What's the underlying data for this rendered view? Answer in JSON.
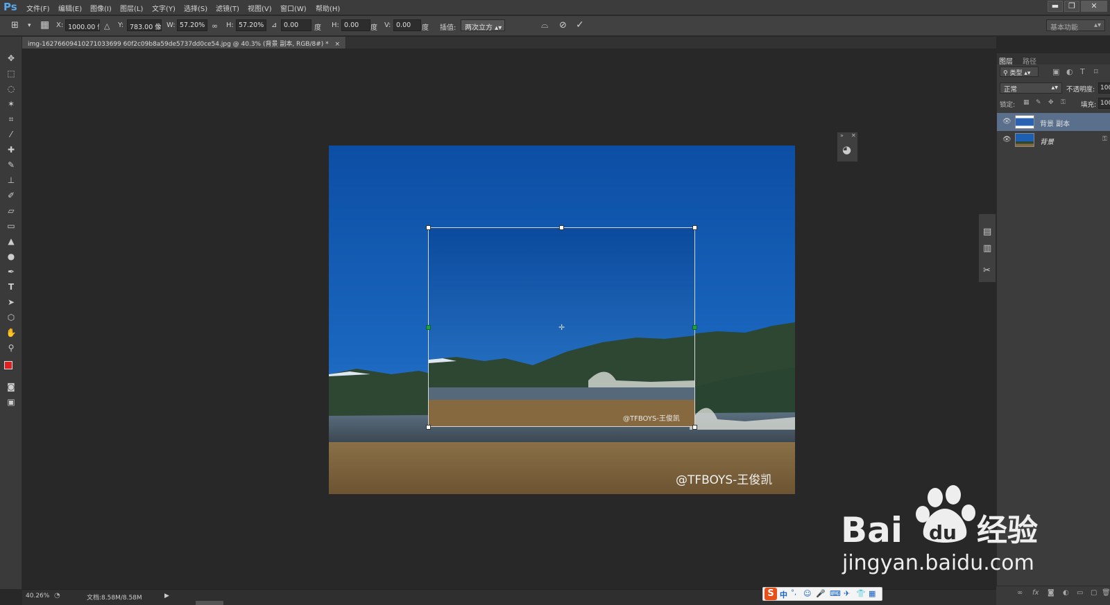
{
  "app": {
    "logo": "Ps"
  },
  "menu": [
    "文件(F)",
    "编辑(E)",
    "图像(I)",
    "图层(L)",
    "文字(Y)",
    "选择(S)",
    "滤镜(T)",
    "视图(V)",
    "窗口(W)",
    "帮助(H)"
  ],
  "window_controls": {
    "minimize": "▬",
    "restore": "❐",
    "close": "✕"
  },
  "options": {
    "x_label": "X:",
    "x_value": "1000.00 像",
    "y_label": "Y:",
    "y_value": "783.00 像",
    "w_label": "W:",
    "w_value": "57.20%",
    "h_label": "H:",
    "h_value": "57.20%",
    "angle_value": "0.00",
    "angle_unit": "度",
    "hskew_label": "H:",
    "hskew_value": "0.00",
    "hskew_unit": "度",
    "vskew_label": "V:",
    "vskew_value": "0.00",
    "vskew_unit": "度",
    "interp_label": "插值:",
    "interp_value": "两次立方",
    "workspace": "基本功能"
  },
  "document": {
    "tab_title": "img-16276609410271033699 60f2c09b8a59de5737dd0ce54.jpg @ 40.3% (背景 副本, RGB/8#) *",
    "tab_close": "×",
    "watermark_large": "@TFBOYS-王俊凯",
    "watermark_small": "@TFBOYS-王俊凯"
  },
  "layers_panel": {
    "tabs": [
      "图层",
      "路径"
    ],
    "filter_kind": "类型",
    "blend_mode": "正常",
    "opacity_label": "不透明度:",
    "opacity_value": "100",
    "lock_label": "锁定:",
    "fill_label": "填充:",
    "fill_value": "100",
    "layers": [
      {
        "name": "背景 副本",
        "selected": true
      },
      {
        "name": "背景",
        "selected": false
      }
    ]
  },
  "status": {
    "zoom": "40.26%",
    "doc_info": "文档:8.58M/8.58M"
  },
  "ime": {
    "label": "中"
  },
  "site_watermark": {
    "brand_a": "Bai",
    "brand_b": "du",
    "brand_c": "经验",
    "url": "jingyan.baidu.com"
  },
  "colors": {
    "foreground": "#e02020",
    "background": "#000000",
    "accent": "#5aa7e8"
  }
}
